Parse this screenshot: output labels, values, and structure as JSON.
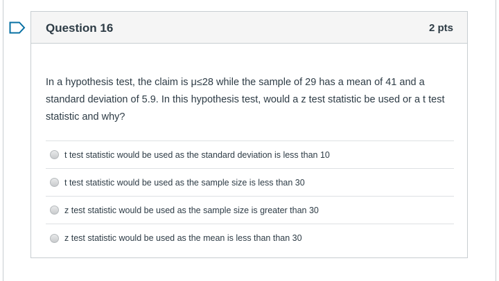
{
  "question": {
    "title": "Question 16",
    "points": "2 pts",
    "text": "In a hypothesis test, the claim is μ≤28 while the sample of 29 has a mean of 41 and a standard deviation of 5.9. In this hypothesis test, would a z test statistic be used or a t test statistic and why?",
    "answers": [
      {
        "label": "t test statistic would be used as the standard deviation is less than 10",
        "selected": false
      },
      {
        "label": "t test statistic would be used as the sample size is less than 30",
        "selected": false
      },
      {
        "label": "z test statistic would be used as the sample size is greater than 30",
        "selected": false
      },
      {
        "label": "z test statistic would be used as the mean is less than than 30",
        "selected": false
      }
    ]
  },
  "flag": {
    "icon": "flag-bookmark-icon",
    "color": "#0770a3"
  },
  "colors": {
    "header_bg": "#f5f5f5",
    "border": "#c7cdd1",
    "text": "#2d3b45"
  }
}
